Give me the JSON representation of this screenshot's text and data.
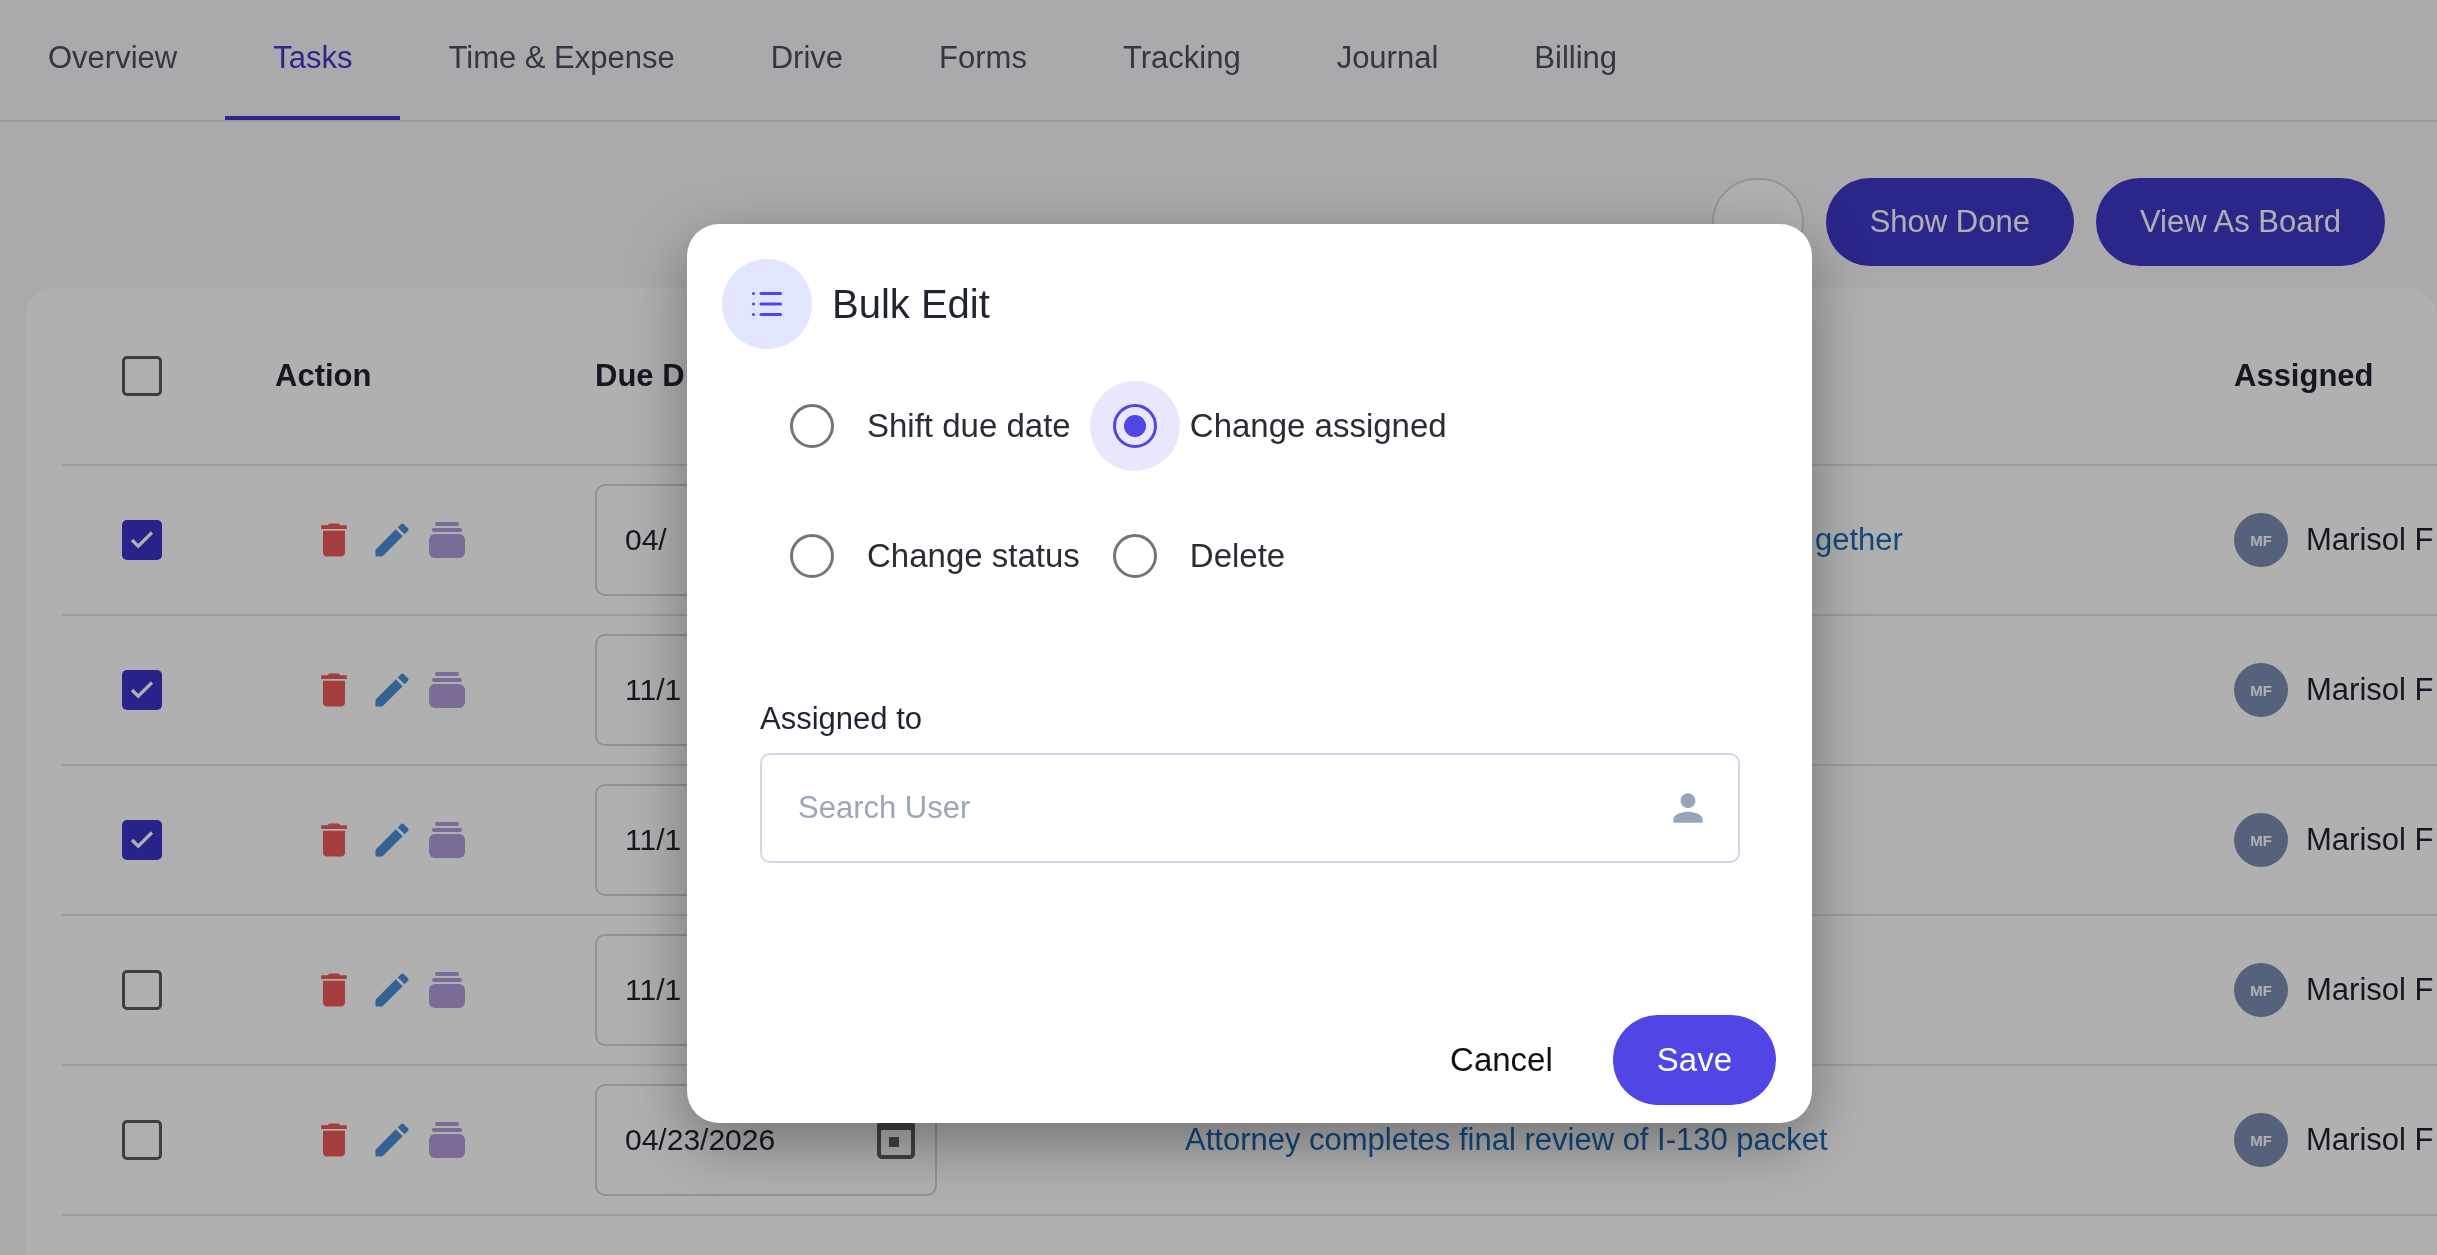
{
  "tabs": [
    {
      "label": "Overview",
      "selected": false
    },
    {
      "label": "Tasks",
      "selected": true
    },
    {
      "label": "Time & Expense",
      "selected": false
    },
    {
      "label": "Drive",
      "selected": false
    },
    {
      "label": "Forms",
      "selected": false
    },
    {
      "label": "Tracking",
      "selected": false
    },
    {
      "label": "Journal",
      "selected": false
    },
    {
      "label": "Billing",
      "selected": false
    }
  ],
  "toolbar": [
    {
      "kind": "outline"
    },
    {
      "label": "Show Done",
      "kind": "filled"
    },
    {
      "label": "View As Board",
      "kind": "filled"
    }
  ],
  "table": {
    "select_all": {
      "checked": false
    },
    "columns": [
      "Action",
      "Due D",
      "Assigned"
    ],
    "rows": [
      {
        "checked": true,
        "due": "04/",
        "title": "gether",
        "initials": "MF",
        "assignee": "Marisol F"
      },
      {
        "checked": true,
        "due": "11/1",
        "initials": "MF",
        "assignee": "Marisol F"
      },
      {
        "checked": true,
        "due": "11/1",
        "initials": "MF",
        "assignee": "Marisol F"
      },
      {
        "checked": false,
        "due": "11/1",
        "initials": "MF",
        "assignee": "Marisol F"
      },
      {
        "checked": false,
        "due": "04/23/2026",
        "title": "Attorney completes final review of I-130 packet",
        "initials": "MF",
        "assignee": "Marisol F"
      }
    ]
  },
  "dialog": {
    "title": "Bulk Edit",
    "options": [
      {
        "label": "Shift due date",
        "selected": false
      },
      {
        "label": "Change assigned",
        "selected": true
      },
      {
        "label": "Change status",
        "selected": false
      },
      {
        "label": "Delete",
        "selected": false
      }
    ],
    "field_label": "Assigned to",
    "field": {
      "placeholder": "Search User"
    },
    "buttons": [
      {
        "label": "Cancel",
        "kind": "text"
      },
      {
        "label": "Save",
        "kind": "primary"
      }
    ]
  }
}
